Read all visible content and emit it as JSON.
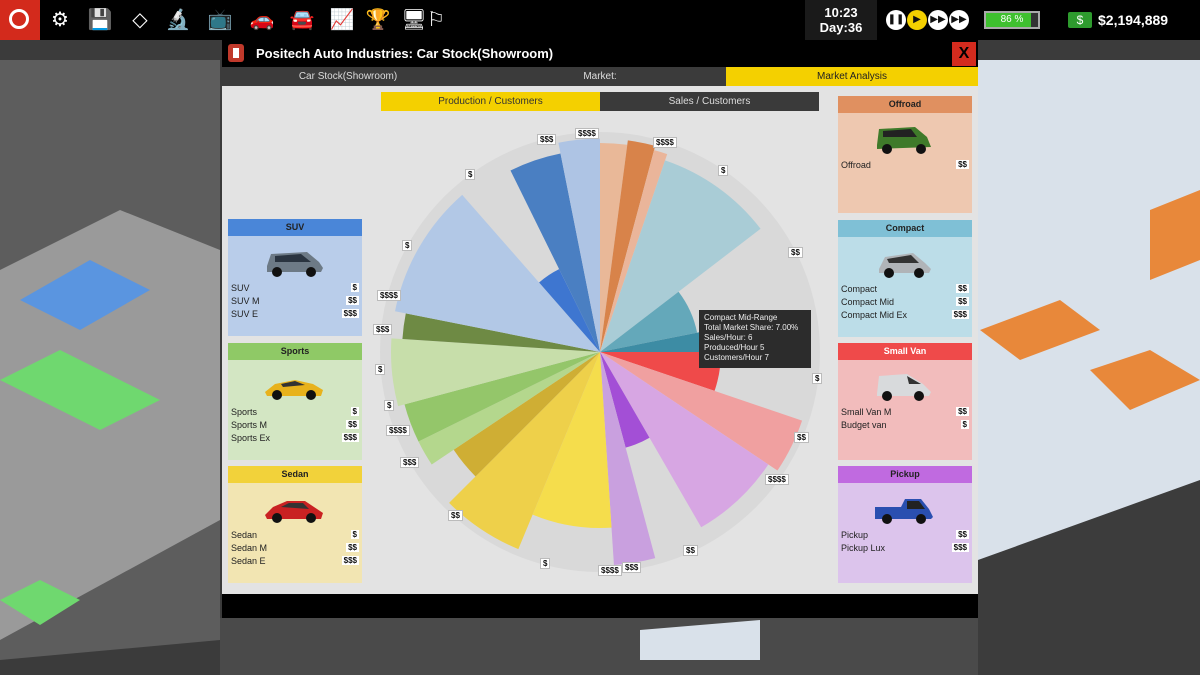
{
  "hud": {
    "time": "10:23",
    "day": "Day:36",
    "battery": "86 %",
    "battery_level": 0.86,
    "cash": "$2,194,889",
    "cash_icon_symbol": "$"
  },
  "dialog": {
    "title": "Positech Auto Industries: Car Stock(Showroom)",
    "close_label": "X",
    "tabs": [
      {
        "label": "Car Stock(Showroom)"
      },
      {
        "label": "Market:"
      },
      {
        "label": "Market Analysis"
      }
    ],
    "subtabs": [
      {
        "label": "Production / Customers"
      },
      {
        "label": "Sales / Customers"
      }
    ]
  },
  "categories": {
    "suv": {
      "title": "SUV",
      "color": "#4a86d8",
      "bg": "#b9cdea",
      "models": [
        {
          "name": "SUV",
          "price": "$"
        },
        {
          "name": "SUV M",
          "price": "$$"
        },
        {
          "name": "SUV E",
          "price": "$$$"
        }
      ]
    },
    "sports": {
      "title": "Sports",
      "color": "#8fc966",
      "bg": "#d3e6c3",
      "models": [
        {
          "name": "Sports",
          "price": "$"
        },
        {
          "name": "Sports M",
          "price": "$$"
        },
        {
          "name": "Sports Ex",
          "price": "$$$"
        }
      ]
    },
    "sedan": {
      "title": "Sedan",
      "color": "#f2d23a",
      "bg": "#f2e5b2",
      "models": [
        {
          "name": "Sedan",
          "price": "$"
        },
        {
          "name": "Sedan M",
          "price": "$$"
        },
        {
          "name": "Sedan E",
          "price": "$$$"
        }
      ]
    },
    "offroad": {
      "title": "Offroad",
      "color": "#e09060",
      "bg": "#eec8b0",
      "models": [
        {
          "name": "Offroad",
          "price": "$$"
        }
      ]
    },
    "compact": {
      "title": "Compact",
      "color": "#7fc0d6",
      "bg": "#bcdde8",
      "models": [
        {
          "name": "Compact",
          "price": "$$"
        },
        {
          "name": "Compact Mid",
          "price": "$$"
        },
        {
          "name": "Compact Mid Ex",
          "price": "$$$"
        }
      ]
    },
    "smallvan": {
      "title": "Small Van",
      "color": "#ef4a4a",
      "bg": "#f2bcbc",
      "models": [
        {
          "name": "Small Van M",
          "price": "$$"
        },
        {
          "name": "Budget van",
          "price": "$"
        }
      ]
    },
    "pickup": {
      "title": "Pickup",
      "color": "#c06ae0",
      "bg": "#dcc4ec",
      "models": [
        {
          "name": "Pickup",
          "price": "$$"
        },
        {
          "name": "Pickup Lux",
          "price": "$$$"
        }
      ]
    }
  },
  "tooltip": {
    "lines": [
      "Compact  Mid-Range",
      "Total Market Share:  7.00%",
      "Sales/Hour:  6",
      "Produced/Hour  5",
      "Customers/Hour  7"
    ]
  },
  "pie_labels": [
    "$",
    "$$",
    "$$$",
    "$$$$"
  ],
  "chart_data": {
    "type": "pie",
    "slices": [
      {
        "segment": "Offroad",
        "color": "#e9b898",
        "share": 2.0
      },
      {
        "segment": "Offroad",
        "color": "#d8834a",
        "share": 2.0
      },
      {
        "segment": "Offroad",
        "color": "#eab59a",
        "share": 1.0
      },
      {
        "segment": "Compact",
        "color": "#a9ccd6",
        "share": 9.0
      },
      {
        "segment": "Compact",
        "color": "#64a8ba",
        "share": 7.0
      },
      {
        "segment": "Compact",
        "color": "#3d8ca4",
        "share": 3.0
      },
      {
        "segment": "Small Van",
        "color": "#ef4a4a",
        "share": 5.0
      },
      {
        "segment": "Small Van",
        "color": "#f0a0a0",
        "share": 4.0
      },
      {
        "segment": "Pickup",
        "color": "#d7a6e3",
        "share": 7.0
      },
      {
        "segment": "Pickup",
        "color": "#a34fd6",
        "share": 4.0
      },
      {
        "segment": "Pickup",
        "color": "#c9a0df",
        "share": 3.0
      },
      {
        "segment": "Sedan",
        "color": "#f5dd4c",
        "share": 7.0
      },
      {
        "segment": "Sedan",
        "color": "#eed04a",
        "share": 6.0
      },
      {
        "segment": "Sedan",
        "color": "#cfae34",
        "share": 3.0
      },
      {
        "segment": "Sports",
        "color": "#b4d78d",
        "share": 2.0
      },
      {
        "segment": "Sports",
        "color": "#94c66a",
        "share": 3.0
      },
      {
        "segment": "Sports",
        "color": "#c7deaa",
        "share": 5.0
      },
      {
        "segment": "Sports",
        "color": "#6e8a44",
        "share": 2.0
      },
      {
        "segment": "SUV",
        "color": "#b2c8e6",
        "share": 10.0
      },
      {
        "segment": "SUV",
        "color": "#3e76d0",
        "share": 4.0
      },
      {
        "segment": "SUV",
        "color": "#4a7fc2",
        "share": 4.0
      },
      {
        "segment": "SUV",
        "color": "#aec4e4",
        "share": 3.0
      }
    ]
  }
}
